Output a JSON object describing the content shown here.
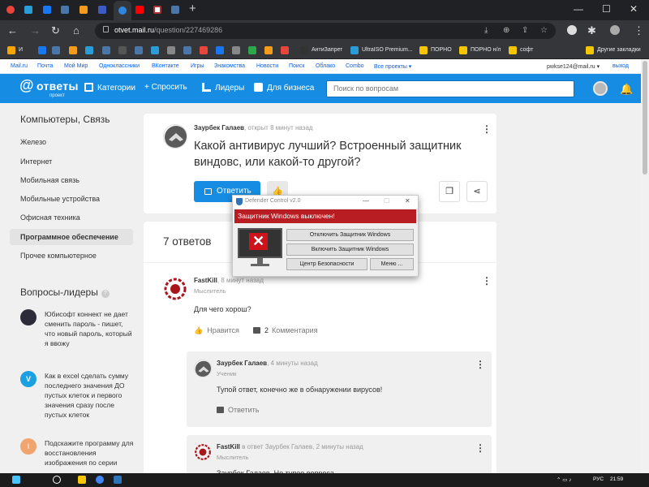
{
  "browser": {
    "url_host": "otvet.mail.ru",
    "url_path": "/question/227469286",
    "new_tab": "+",
    "win_min": "—",
    "win_max": "☐",
    "win_close": "✕",
    "tab_icon_colors": [
      "#e8453c",
      "#2a9cd8",
      "#1877f2",
      "#4a76a8",
      "#f59c1a",
      "#3a3a9a",
      "#888",
      "#ff0000",
      "#4a76a8",
      "#2a9cd8",
      "#2e86de"
    ],
    "bookmarks": [
      {
        "label": "И",
        "color": "#f7a600"
      },
      {
        "label": "",
        "color": "#1877f2"
      },
      {
        "label": "",
        "color": "#4a76a8"
      },
      {
        "label": "",
        "color": "#f59c1a"
      },
      {
        "label": "",
        "color": "#2a9cd8"
      },
      {
        "label": "",
        "color": "#4a76a8"
      },
      {
        "label": "",
        "color": "#000"
      },
      {
        "label": "",
        "color": "#888"
      },
      {
        "label": "",
        "color": "#e8453c"
      },
      {
        "label": "АнтиЗапрет",
        "color": "#333"
      },
      {
        "label": "UltraISO Premium...",
        "color": "#2a9cd8"
      },
      {
        "label": "ПОРНО",
        "color": "#f7c600"
      },
      {
        "label": "ПОРНО н/л",
        "color": "#f7c600"
      },
      {
        "label": "софт",
        "color": "#f7c600"
      },
      {
        "label": "Другие закладки",
        "color": "#f7c600"
      }
    ]
  },
  "mailbar": {
    "links": [
      "Mail.ru",
      "Почта",
      "Мой Мир",
      "Одноклассники",
      "ВКонтакте",
      "Игры",
      "Знакомства",
      "Новости",
      "Поиск",
      "Облако",
      "Combo",
      "Все проекты ▾"
    ],
    "user": "pwkse124@mail.ru ▾",
    "logout": "выход"
  },
  "header": {
    "logo_at": "@",
    "logo_word": "ответы",
    "logo_sub": "проект",
    "nav": [
      "Категории",
      "+ Спросить",
      "Лидеры",
      "Для бизнеса"
    ],
    "search_placeholder": "Поиск по вопросам"
  },
  "sidebar": {
    "title": "Компьютеры, Связь",
    "categories": [
      "Железо",
      "Интернет",
      "Мобильная связь",
      "Мобильные устройства",
      "Офисная техника",
      "Программное обеспечение",
      "Прочее компьютерное"
    ],
    "selected": "Программное обеспечение",
    "leaders_title": "Вопросы-лидеры",
    "leaders": [
      {
        "text": "Юбисофт коннект не дает сменить пароль - пишет, что новый пароль, который я ввожу",
        "avatar_color": "#2b2b3a",
        "avatar_letter": ""
      },
      {
        "text": "Как в excel сделать сумму последнего значения ДО пустых клеток и первого значения сразу после пустых клеток",
        "avatar_color": "#1ba1e2",
        "avatar_letter": "V"
      },
      {
        "text": "Подскажите программу для восстановления изображения по серии",
        "avatar_color": "#f0a56e",
        "avatar_letter": "I"
      }
    ]
  },
  "question": {
    "author": "Заурбек Галаев",
    "meta": ", открыт 8 минут назад",
    "title": "Какой антивирус лучший? Встроенный защитник виндовс, или какой-то другой?",
    "answer_button": "Ответить"
  },
  "answers": {
    "count_label": "7 ответов",
    "items": [
      {
        "author": "FastKill",
        "meta": ", 8 минут назад",
        "rank": "Мыслитель",
        "text": "Для чего хорош?",
        "like_label": "Нравится",
        "comments_count": "2",
        "comments_label": "Комментария"
      }
    ],
    "comments": [
      {
        "author": "Заурбек Галаев",
        "meta": ", 4 минуты назад",
        "rank": "Ученик",
        "text": "Тупой ответ, конечно же в обнаружении вирусов!",
        "reply_label": "Ответить"
      },
      {
        "author": "FastKill",
        "meta": " в ответ Заурбек Галаев, 2 минуты назад",
        "rank": "Мыслитель",
        "text": "Заурбек Галаев, Не тупее вопроса"
      }
    ]
  },
  "defender": {
    "title": "Defender Control v2.0",
    "banner": "Защитник Windows выключен!",
    "x_symbol": "✕",
    "btn_disable": "Отключить Защитник Windows",
    "btn_enable": "Включить Защитник Windows",
    "btn_center": "Центр Безопасности",
    "btn_menu": "Меню ...",
    "banner_color": "#b91d24"
  },
  "taskbar": {
    "lang": "РУС",
    "time": "21:59"
  }
}
